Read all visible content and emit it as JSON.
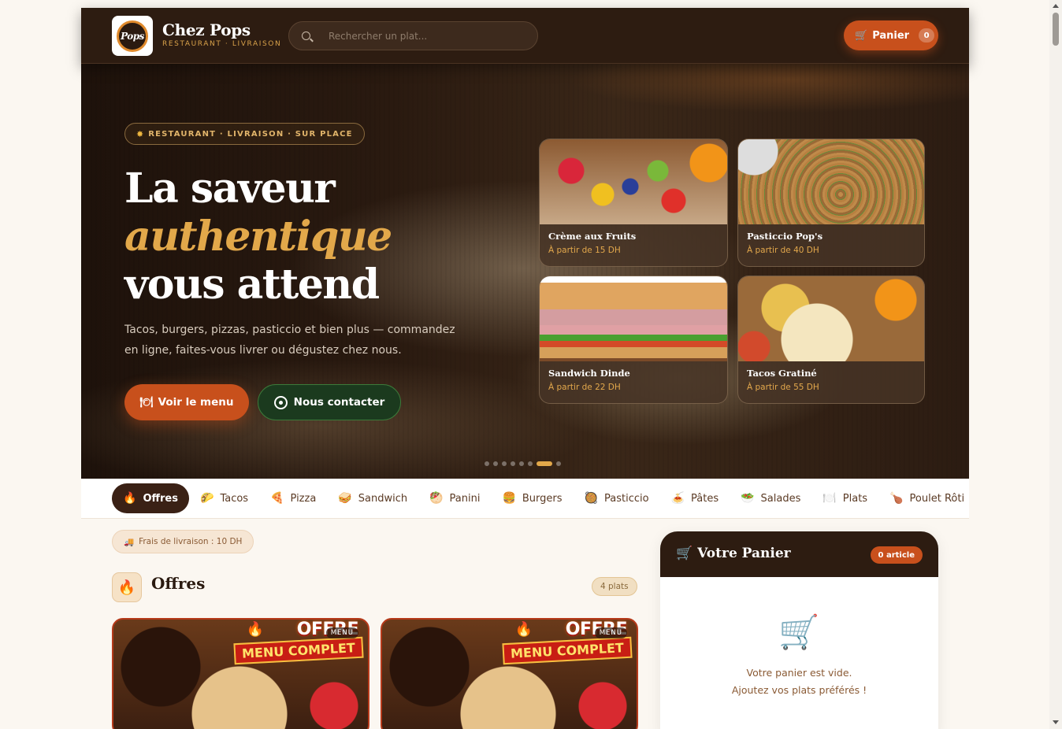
{
  "header": {
    "logo_text": "Pops",
    "brand_name": "Chez Pops",
    "brand_tagline": "RESTAURANT · LIVRAISON",
    "search_placeholder": "Rechercher un plat...",
    "cart_label": "Panier",
    "cart_count": "0"
  },
  "hero": {
    "pill": "RESTAURANT · LIVRAISON · SUR PLACE",
    "title_line1": "La saveur",
    "title_line2": "authentique",
    "title_line3": "vous attend",
    "description": "Tacos, burgers, pizzas, pasticcio et bien plus — commandez en ligne, faites-vous livrer ou dégustez chez nous.",
    "btn_menu": "Voir le menu",
    "btn_contact": "Nous contacter",
    "cards": [
      {
        "name": "Crème aux Fruits",
        "price": "À partir de 15 DH"
      },
      {
        "name": "Pasticcio Pop's",
        "price": "À partir de 40 DH"
      },
      {
        "name": "Sandwich Dinde",
        "price": "À partir de 22 DH"
      },
      {
        "name": "Tacos Gratiné",
        "price": "À partir de 55 DH"
      }
    ],
    "carousel_active_index": 6,
    "carousel_count": 8
  },
  "categories": [
    {
      "icon": "🔥",
      "label": "Offres",
      "active": true
    },
    {
      "icon": "🌮",
      "label": "Tacos"
    },
    {
      "icon": "🍕",
      "label": "Pizza"
    },
    {
      "icon": "🥪",
      "label": "Sandwich"
    },
    {
      "icon": "🥙",
      "label": "Panini"
    },
    {
      "icon": "🍔",
      "label": "Burgers"
    },
    {
      "icon": "🥘",
      "label": "Pasticcio"
    },
    {
      "icon": "🍝",
      "label": "Pâtes"
    },
    {
      "icon": "🥗",
      "label": "Salades"
    },
    {
      "icon": "🍽️",
      "label": "Plats"
    },
    {
      "icon": "🍗",
      "label": "Poulet Rôti"
    }
  ],
  "main": {
    "delivery_fee": "Frais de livraison : 10 DH",
    "section_icon": "🔥",
    "section_title": "Offres",
    "section_count": "4 plats",
    "offer_cards": [
      {
        "banner_top": "OFFRE",
        "banner_bottom": "MENU COMPLET",
        "tag": "MENU"
      },
      {
        "banner_top": "OFFRE",
        "banner_bottom": "MENU COMPLET",
        "tag": "MENU"
      }
    ]
  },
  "cart": {
    "title": "Votre Panier",
    "count_badge": "0 article",
    "empty_line1": "Votre panier est vide.",
    "empty_line2": "Ajoutez vos plats préférés !"
  },
  "colors": {
    "dark_brown": "#2d1c11",
    "accent_orange": "#c8501c",
    "gold": "#e2a84a",
    "cream": "#fbf7f1"
  }
}
